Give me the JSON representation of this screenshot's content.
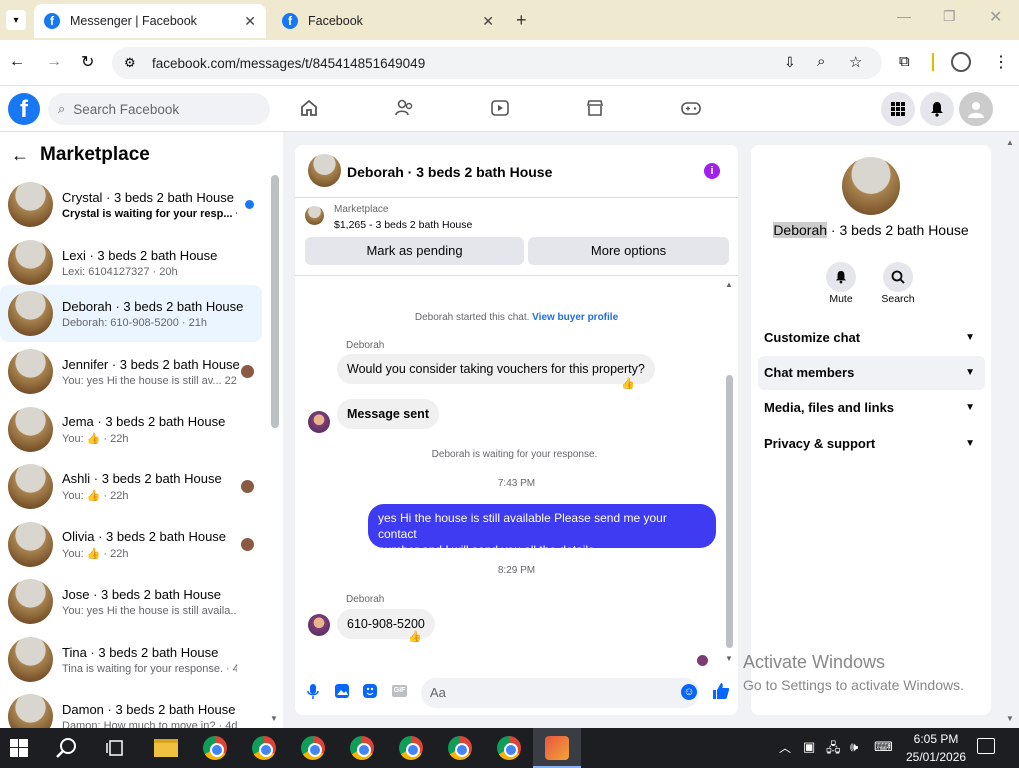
{
  "browser": {
    "tabs": [
      {
        "title": "Messenger | Facebook",
        "active": true
      },
      {
        "title": "Facebook",
        "active": false
      }
    ],
    "url": "facebook.com/messages/t/845414851649049"
  },
  "fb": {
    "search_placeholder": "Search Facebook"
  },
  "left": {
    "title": "Marketplace",
    "conversations": [
      {
        "name": "Crystal · 3 beds 2 bath House",
        "preview": "Crystal is waiting for your resp... · 3h",
        "unread": true
      },
      {
        "name": "Lexi · 3 beds 2 bath House",
        "preview": "Lexi: 6104127327 · 20h"
      },
      {
        "name": "Deborah · 3 beds 2 bath House",
        "preview": "Deborah: 610-908-5200 · 21h",
        "selected": true
      },
      {
        "name": "Jennifer · 3 beds 2 bath House",
        "preview": "You: yes Hi the house is still av...  22h"
      },
      {
        "name": "Jema · 3 beds 2 bath House",
        "preview": "You: 👍 · 22h"
      },
      {
        "name": "Ashli · 3 beds 2 bath House",
        "preview": "You: 👍 · 22h"
      },
      {
        "name": "Olivia · 3 beds 2 bath House",
        "preview": "You: 👍 · 22h"
      },
      {
        "name": "Jose · 3 beds 2 bath House",
        "preview": "You: yes Hi the house is still availa... · 3d"
      },
      {
        "name": "Tina · 3 beds 2 bath House",
        "preview": "Tina is waiting for your response. · 4d"
      },
      {
        "name": "Damon · 3 beds 2 bath House",
        "preview": "Damon: How much to move in? · 4d"
      }
    ]
  },
  "chat": {
    "title": "Deborah · 3 beds 2 bath House",
    "marketplace_label": "Marketplace",
    "listing": "$1,265 - 3 beds 2 bath House",
    "mark_pending": "Mark as pending",
    "more_options": "More options",
    "started": "Deborah started this chat.",
    "view_profile": "View buyer profile",
    "sender1": "Deborah",
    "msg1": "Would you consider taking vouchers for this property?",
    "msg_sent": "Message sent",
    "waiting": "Deborah is waiting for your response.",
    "time1": "7:43 PM",
    "reply_line1": "yes Hi the house is still available Please send me your contact",
    "reply_line2": "number and I will send you all the details",
    "time2": "8:29 PM",
    "sender2": "Deborah",
    "msg2": "610-908-5200",
    "composer_placeholder": "Aa"
  },
  "right": {
    "title_highlight": "Deborah",
    "title_rest": " · 3 beds 2 bath House",
    "mute": "Mute",
    "search": "Search",
    "sections": [
      "Customize chat",
      "Chat members",
      "Media, files and links",
      "Privacy & support"
    ]
  },
  "watermark": {
    "line1": "Activate Windows",
    "line2": "Go to Settings to activate Windows."
  },
  "taskbar": {
    "time": "6:05 PM",
    "date": "25/01/2026"
  },
  "colors": {
    "fb_blue": "#1877f2",
    "my_bubble": "#3e3bf3",
    "info_purple": "#a020f0"
  }
}
